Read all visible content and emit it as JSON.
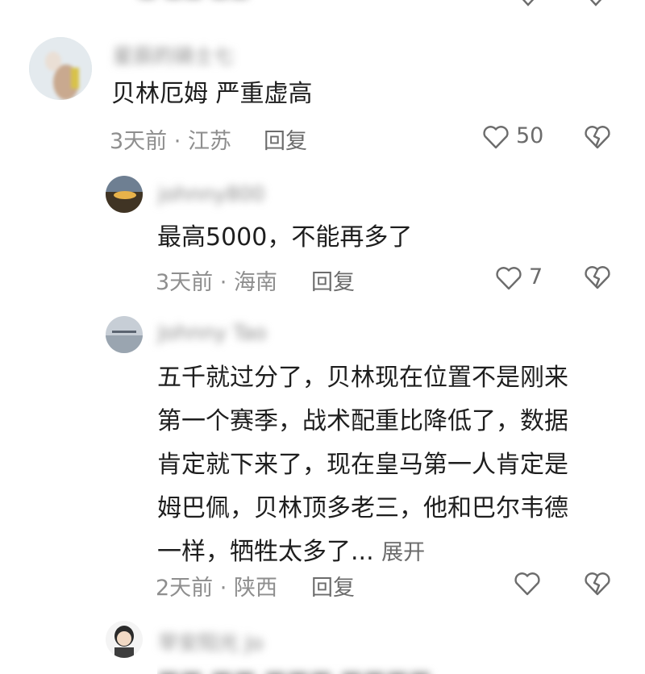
{
  "top_partial": {},
  "comments": [
    {
      "author": "星辰的骑士七",
      "text": "贝林厄姆 严重虚高",
      "meta_time": "3天前",
      "meta_region": "江苏",
      "reply_label": "回复",
      "like_count": "50"
    },
    {
      "author": "johnny800",
      "text": "最高5000，不能再多了",
      "meta_time": "3天前",
      "meta_region": "海南",
      "reply_label": "回复",
      "like_count": "7"
    },
    {
      "author": "Johnny Tao",
      "text_lines": [
        "五千就过分了，贝林现在位置不是刚来",
        "第一个赛季，战术配重比降低了，数据",
        "肯定就下来了，现在皇马第一人肯定是",
        "姆巴佩，贝林顶多老三，他和巴尔韦德",
        "一样，牺牲太多了..."
      ],
      "expand_label": "展开",
      "meta_time": "2天前",
      "meta_region": "陕西",
      "reply_label": "回复",
      "like_count": ""
    },
    {
      "author": "早安阳光 Jo"
    }
  ],
  "colors": {
    "text": "#1e1e1e",
    "meta": "#8e8e8e",
    "icon": "#6c6c6c",
    "background": "#ffffff"
  },
  "icons": [
    "heart-outline-icon",
    "broken-heart-icon"
  ]
}
